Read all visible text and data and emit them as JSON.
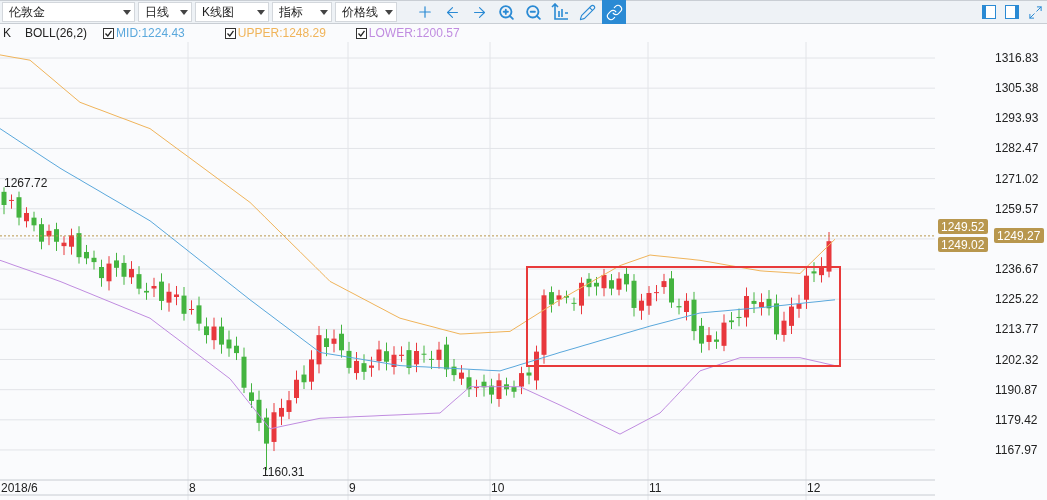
{
  "toolbar": {
    "dropdowns": [
      {
        "label": "伦敦金"
      },
      {
        "label": "日线"
      },
      {
        "label": "K线图"
      },
      {
        "label": "指标"
      },
      {
        "label": "价格线"
      }
    ],
    "tools": [
      {
        "kind": "crosshair",
        "selected": false
      },
      {
        "kind": "back",
        "selected": false
      },
      {
        "kind": "forward",
        "selected": false
      },
      {
        "kind": "zoom-in",
        "selected": false
      },
      {
        "kind": "zoom-out",
        "selected": false
      },
      {
        "kind": "axis",
        "selected": false
      },
      {
        "kind": "pencil",
        "selected": false
      },
      {
        "kind": "link",
        "selected": true
      }
    ]
  },
  "legend": {
    "series": "K",
    "indicator": "BOLL(26,2)",
    "lines": [
      {
        "label": "MID:1224.43",
        "checked": true,
        "color": "#5aa8dc"
      },
      {
        "label": "UPPER:1248.29",
        "checked": true,
        "color": "#f0b45a"
      },
      {
        "label": "LOWER:1200.57",
        "checked": true,
        "color": "#c08ce0"
      }
    ]
  },
  "chart": {
    "y_ticks": [
      "1316.83",
      "1305.38",
      "1293.93",
      "1282.47",
      "1271.02",
      "1259.57",
      "1236.67",
      "1225.22",
      "1213.77",
      "1202.32",
      "1190.87",
      "1179.42",
      "1167.97"
    ],
    "x_labels": [
      "2018/6",
      "8",
      "9",
      "10",
      "11",
      "12"
    ],
    "high_label": "1267.72",
    "low_label": "1160.31",
    "price_tags": [
      {
        "kind": "high",
        "label": "1249.52"
      },
      {
        "kind": "low",
        "label": "1249.02"
      },
      {
        "kind": "last",
        "label": "1249.27"
      }
    ]
  }
}
